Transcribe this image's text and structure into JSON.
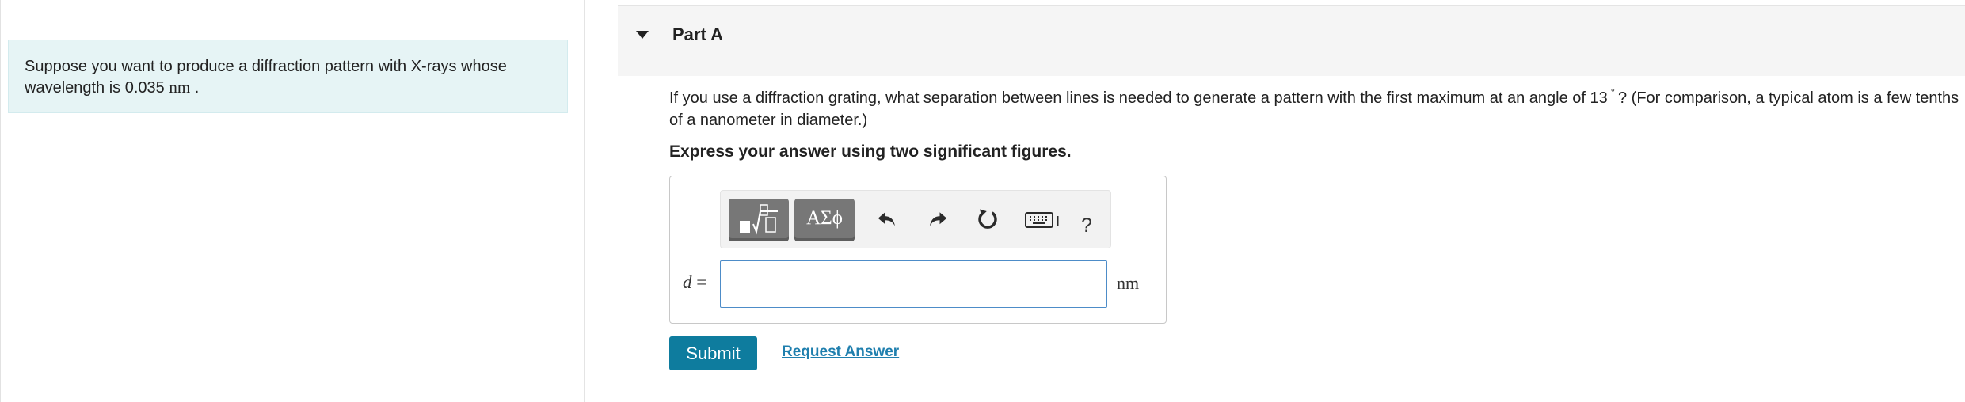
{
  "problem": {
    "text_before": "Suppose you want to produce a diffraction pattern with X-rays whose wavelength is 0.035",
    "unit": "nm",
    "text_after": "."
  },
  "part": {
    "title": "Part A",
    "question_before": "If you use a diffraction grating, what separation between lines is needed to generate a pattern with the first maximum at an angle of 13",
    "degree_symbol": "°",
    "question_after": "? (For comparison, a typical atom is a few tenths of a nanometer in diameter.)",
    "instruction": "Express your answer using two significant figures."
  },
  "answer": {
    "variable": "d",
    "equals": "=",
    "unit": "nm",
    "value": ""
  },
  "toolbar": {
    "symbols_label": "ΑΣϕ",
    "help_label": "?",
    "icons": [
      "templates-icon",
      "greek-symbols-icon",
      "undo-icon",
      "redo-icon",
      "reset-icon",
      "keyboard-icon",
      "help-icon"
    ]
  },
  "actions": {
    "submit_label": "Submit",
    "request_answer_label": "Request Answer"
  },
  "colors": {
    "problem_bg": "#e6f4f5",
    "part_header_bg": "#f5f5f5",
    "toolbar_button": "#777777",
    "input_border": "#4d8cc8",
    "submit_bg": "#0e7c9e",
    "link": "#1f7fae"
  }
}
